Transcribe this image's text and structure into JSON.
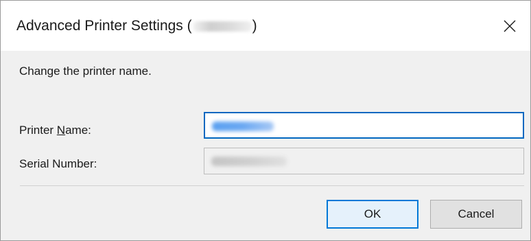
{
  "dialog": {
    "title_prefix": "Advanced Printer Settings (",
    "title_suffix": ")",
    "close_glyph": "close-icon"
  },
  "form": {
    "instruction": "Change the printer name.",
    "printer_name_label_pre": "Printer ",
    "printer_name_label_mnemonic": "N",
    "printer_name_label_post": "ame:",
    "serial_number_label": "Serial Number:"
  },
  "buttons": {
    "ok_label": "OK",
    "cancel_label": "Cancel"
  },
  "colors": {
    "accent": "#0078d7",
    "input_focus": "#0067c0",
    "client_bg": "#f0f0f0"
  }
}
